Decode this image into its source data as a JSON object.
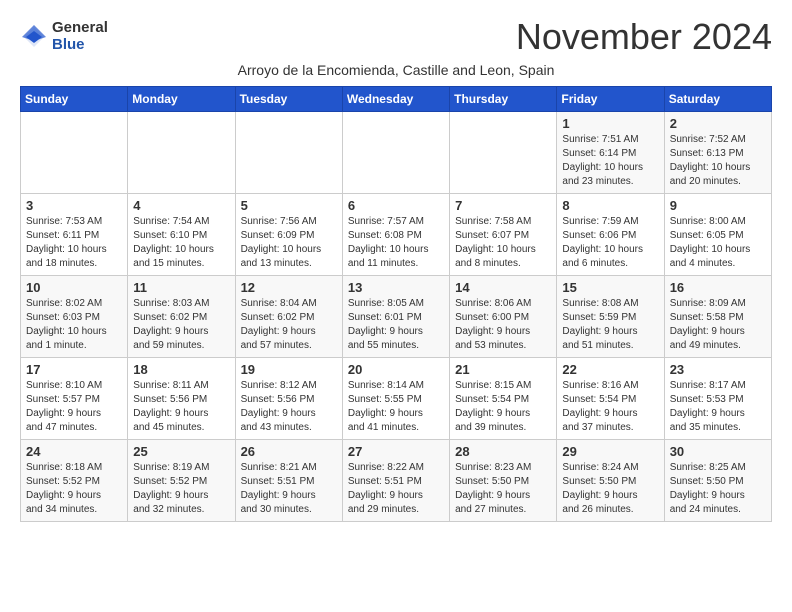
{
  "header": {
    "logo_general": "General",
    "logo_blue": "Blue",
    "month_title": "November 2024",
    "subtitle": "Arroyo de la Encomienda, Castille and Leon, Spain"
  },
  "days_of_week": [
    "Sunday",
    "Monday",
    "Tuesday",
    "Wednesday",
    "Thursday",
    "Friday",
    "Saturday"
  ],
  "weeks": [
    [
      {
        "day": "",
        "info": ""
      },
      {
        "day": "",
        "info": ""
      },
      {
        "day": "",
        "info": ""
      },
      {
        "day": "",
        "info": ""
      },
      {
        "day": "",
        "info": ""
      },
      {
        "day": "1",
        "info": "Sunrise: 7:51 AM\nSunset: 6:14 PM\nDaylight: 10 hours\nand 23 minutes."
      },
      {
        "day": "2",
        "info": "Sunrise: 7:52 AM\nSunset: 6:13 PM\nDaylight: 10 hours\nand 20 minutes."
      }
    ],
    [
      {
        "day": "3",
        "info": "Sunrise: 7:53 AM\nSunset: 6:11 PM\nDaylight: 10 hours\nand 18 minutes."
      },
      {
        "day": "4",
        "info": "Sunrise: 7:54 AM\nSunset: 6:10 PM\nDaylight: 10 hours\nand 15 minutes."
      },
      {
        "day": "5",
        "info": "Sunrise: 7:56 AM\nSunset: 6:09 PM\nDaylight: 10 hours\nand 13 minutes."
      },
      {
        "day": "6",
        "info": "Sunrise: 7:57 AM\nSunset: 6:08 PM\nDaylight: 10 hours\nand 11 minutes."
      },
      {
        "day": "7",
        "info": "Sunrise: 7:58 AM\nSunset: 6:07 PM\nDaylight: 10 hours\nand 8 minutes."
      },
      {
        "day": "8",
        "info": "Sunrise: 7:59 AM\nSunset: 6:06 PM\nDaylight: 10 hours\nand 6 minutes."
      },
      {
        "day": "9",
        "info": "Sunrise: 8:00 AM\nSunset: 6:05 PM\nDaylight: 10 hours\nand 4 minutes."
      }
    ],
    [
      {
        "day": "10",
        "info": "Sunrise: 8:02 AM\nSunset: 6:03 PM\nDaylight: 10 hours\nand 1 minute."
      },
      {
        "day": "11",
        "info": "Sunrise: 8:03 AM\nSunset: 6:02 PM\nDaylight: 9 hours\nand 59 minutes."
      },
      {
        "day": "12",
        "info": "Sunrise: 8:04 AM\nSunset: 6:02 PM\nDaylight: 9 hours\nand 57 minutes."
      },
      {
        "day": "13",
        "info": "Sunrise: 8:05 AM\nSunset: 6:01 PM\nDaylight: 9 hours\nand 55 minutes."
      },
      {
        "day": "14",
        "info": "Sunrise: 8:06 AM\nSunset: 6:00 PM\nDaylight: 9 hours\nand 53 minutes."
      },
      {
        "day": "15",
        "info": "Sunrise: 8:08 AM\nSunset: 5:59 PM\nDaylight: 9 hours\nand 51 minutes."
      },
      {
        "day": "16",
        "info": "Sunrise: 8:09 AM\nSunset: 5:58 PM\nDaylight: 9 hours\nand 49 minutes."
      }
    ],
    [
      {
        "day": "17",
        "info": "Sunrise: 8:10 AM\nSunset: 5:57 PM\nDaylight: 9 hours\nand 47 minutes."
      },
      {
        "day": "18",
        "info": "Sunrise: 8:11 AM\nSunset: 5:56 PM\nDaylight: 9 hours\nand 45 minutes."
      },
      {
        "day": "19",
        "info": "Sunrise: 8:12 AM\nSunset: 5:56 PM\nDaylight: 9 hours\nand 43 minutes."
      },
      {
        "day": "20",
        "info": "Sunrise: 8:14 AM\nSunset: 5:55 PM\nDaylight: 9 hours\nand 41 minutes."
      },
      {
        "day": "21",
        "info": "Sunrise: 8:15 AM\nSunset: 5:54 PM\nDaylight: 9 hours\nand 39 minutes."
      },
      {
        "day": "22",
        "info": "Sunrise: 8:16 AM\nSunset: 5:54 PM\nDaylight: 9 hours\nand 37 minutes."
      },
      {
        "day": "23",
        "info": "Sunrise: 8:17 AM\nSunset: 5:53 PM\nDaylight: 9 hours\nand 35 minutes."
      }
    ],
    [
      {
        "day": "24",
        "info": "Sunrise: 8:18 AM\nSunset: 5:52 PM\nDaylight: 9 hours\nand 34 minutes."
      },
      {
        "day": "25",
        "info": "Sunrise: 8:19 AM\nSunset: 5:52 PM\nDaylight: 9 hours\nand 32 minutes."
      },
      {
        "day": "26",
        "info": "Sunrise: 8:21 AM\nSunset: 5:51 PM\nDaylight: 9 hours\nand 30 minutes."
      },
      {
        "day": "27",
        "info": "Sunrise: 8:22 AM\nSunset: 5:51 PM\nDaylight: 9 hours\nand 29 minutes."
      },
      {
        "day": "28",
        "info": "Sunrise: 8:23 AM\nSunset: 5:50 PM\nDaylight: 9 hours\nand 27 minutes."
      },
      {
        "day": "29",
        "info": "Sunrise: 8:24 AM\nSunset: 5:50 PM\nDaylight: 9 hours\nand 26 minutes."
      },
      {
        "day": "30",
        "info": "Sunrise: 8:25 AM\nSunset: 5:50 PM\nDaylight: 9 hours\nand 24 minutes."
      }
    ]
  ]
}
